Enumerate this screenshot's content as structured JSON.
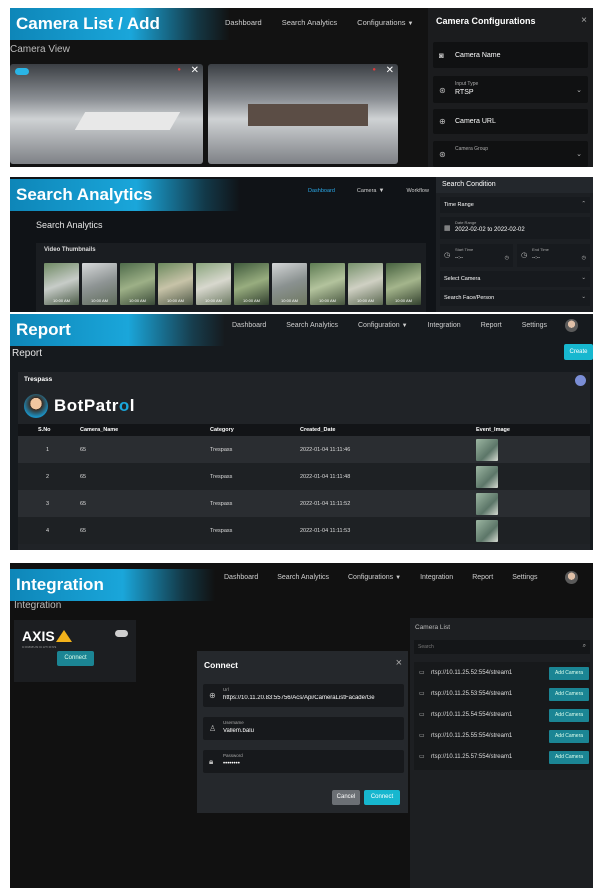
{
  "panel1": {
    "banner": "Camera List / Add",
    "nav": [
      "Dashboard",
      "Search Analytics",
      "Configurations",
      "Ir"
    ],
    "subtitle": "Camera View",
    "config": {
      "title": "Camera Configurations",
      "close": "×",
      "fields": [
        {
          "label": "Camera Name"
        },
        {
          "small": "Input Type",
          "label": "RTSP"
        },
        {
          "label": "Camera URL"
        },
        {
          "small": "Camera Group"
        }
      ]
    }
  },
  "panel2": {
    "banner": "Search Analytics",
    "nav": [
      "Dashboard",
      "Camera",
      "Workflow"
    ],
    "subtitle": "Search Analytics",
    "thumbs_label": "Video Thumbnails",
    "thumb_time": "10:00 AM",
    "condition": {
      "title": "Search Condition",
      "time_range": "Time Range",
      "date_range_label": "Date Range",
      "date_range": "2022-02-02 to 2022-02-02",
      "start_time": "Start Time",
      "end_time": "End Time",
      "time_placeholder": "--:--",
      "select_camera": "Select Camera",
      "search_face": "Search Face/Person"
    }
  },
  "panel3": {
    "banner": "Report",
    "nav": [
      "Dashboard",
      "Search Analytics",
      "Configuration",
      "Integration",
      "Report",
      "Settings"
    ],
    "subtitle": "Report",
    "create": "Create",
    "card_title": "Trespass",
    "logo_pre": "BotPatr",
    "logo_o": "o",
    "logo_post": "l",
    "columns": [
      "S.No",
      "Camera_Name",
      "Category",
      "Created_Date",
      "Event_Image"
    ],
    "rows": [
      [
        "1",
        "65",
        "Trespass",
        "2022-01-04 11:11:46"
      ],
      [
        "2",
        "65",
        "Trespass",
        "2022-01-04 11:11:48"
      ],
      [
        "3",
        "65",
        "Trespass",
        "2022-01-04 11:11:52"
      ],
      [
        "4",
        "65",
        "Trespass",
        "2022-01-04 11:11:53"
      ]
    ]
  },
  "panel4": {
    "banner": "Integration",
    "nav": [
      "Dashboard",
      "Search Analytics",
      "Configurations",
      "Integration",
      "Report",
      "Settings"
    ],
    "subtitle": "Integration",
    "axis_logo": "AXIS",
    "axis_sub": "COMMUNICATIONS",
    "connect_small": "Connect",
    "modal": {
      "title": "Connect",
      "close": "×",
      "url_label": "Url",
      "url_value": "https://10.11.20.83:55756/Acs/Api/CameraListFacade/Ge",
      "username_label": "Username",
      "username_value": "Vallem.balu",
      "password_label": "Password",
      "password_value": "••••••••",
      "cancel": "Cancel",
      "connect": "Connect"
    },
    "camera_list": {
      "title": "Camera List",
      "search_placeholder": "Search",
      "add_label": "Add Camera",
      "items": [
        "rtsp://10.11.25.52:554/stream1",
        "rtsp://10.11.25.53:554/stream1",
        "rtsp://10.11.25.54:554/stream1",
        "rtsp://10.11.25.55:554/stream1",
        "rtsp://10.11.25.57:554/stream1"
      ]
    }
  }
}
